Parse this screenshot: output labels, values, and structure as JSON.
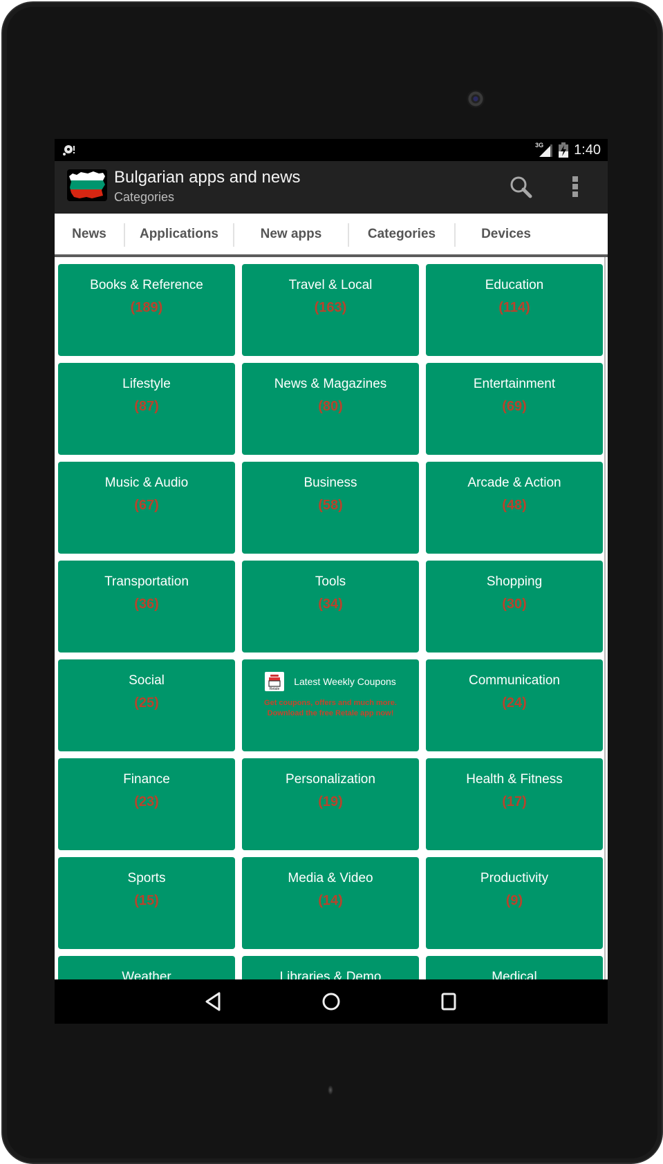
{
  "status_bar": {
    "notification_icon": "sync-alert-icon",
    "network_label": "3G",
    "signal_icon": "signal-icon",
    "battery_icon": "battery-charging-icon",
    "time": "1:40"
  },
  "action_bar": {
    "app_icon": "bulgaria-flag-map-icon",
    "title": "Bulgarian apps and news",
    "subtitle": "Categories",
    "search_icon": "search-icon",
    "menu_icon": "overflow-menu-icon"
  },
  "tabs": [
    {
      "label": "News"
    },
    {
      "label": "Applications"
    },
    {
      "label": "New apps"
    },
    {
      "label": "Categories",
      "active": true
    },
    {
      "label": "Devices"
    }
  ],
  "categories": [
    {
      "name": "Books & Reference",
      "count": "(189)"
    },
    {
      "name": "Travel & Local",
      "count": "(163)"
    },
    {
      "name": "Education",
      "count": "(114)"
    },
    {
      "name": "Lifestyle",
      "count": "(87)"
    },
    {
      "name": "News & Magazines",
      "count": "(80)"
    },
    {
      "name": "Entertainment",
      "count": "(69)"
    },
    {
      "name": "Music & Audio",
      "count": "(67)"
    },
    {
      "name": "Business",
      "count": "(58)"
    },
    {
      "name": "Arcade & Action",
      "count": "(48)"
    },
    {
      "name": "Transportation",
      "count": "(36)"
    },
    {
      "name": "Tools",
      "count": "(34)"
    },
    {
      "name": "Shopping",
      "count": "(30)"
    },
    {
      "name": "Social",
      "count": "(25)"
    },
    {
      "type": "ad"
    },
    {
      "name": "Communication",
      "count": "(24)"
    },
    {
      "name": "Finance",
      "count": "(23)"
    },
    {
      "name": "Personalization",
      "count": "(19)"
    },
    {
      "name": "Health & Fitness",
      "count": "(17)"
    },
    {
      "name": "Sports",
      "count": "(15)"
    },
    {
      "name": "Media & Video",
      "count": "(14)"
    },
    {
      "name": "Productivity",
      "count": "(9)"
    },
    {
      "name": "Weather",
      "count": ""
    },
    {
      "name": "Libraries & Demo",
      "count": ""
    },
    {
      "name": "Medical",
      "count": ""
    }
  ],
  "ad": {
    "logo_label": "Retale",
    "title": "Latest Weekly Coupons",
    "line1": "Get coupons, offers and much more.",
    "line2": "Download the free Retale app now!"
  },
  "nav_bar": {
    "back_icon": "back-icon",
    "home_icon": "home-icon",
    "recents_icon": "recents-icon"
  },
  "colors": {
    "tile_bg": "#00966a",
    "tile_text": "#ffffff",
    "count_text": "#b8432c",
    "action_bar_bg": "#222222",
    "tab_text": "#555555"
  }
}
